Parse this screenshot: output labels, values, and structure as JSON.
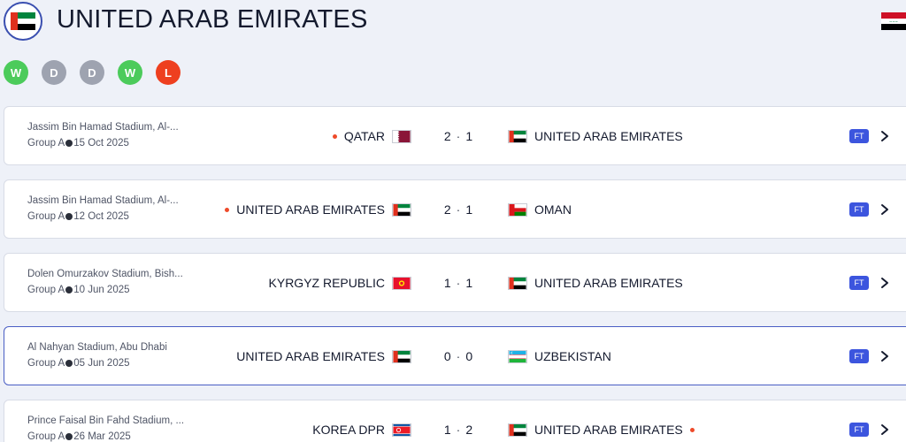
{
  "team": {
    "name": "UNITED ARAB EMIRATES",
    "badge_icon": "uae-flag-icon",
    "opponent_flag_icon": "iraq-flag-icon"
  },
  "form": [
    "W",
    "D",
    "D",
    "W",
    "L"
  ],
  "colors": {
    "win": "#4ccb5b",
    "draw": "#9ea3b0",
    "loss": "#ee3f1f",
    "ft_badge": "#3c55de",
    "selected_border": "#4a5ec4"
  },
  "matches": [
    {
      "venue": "Jassim Bin Hamad Stadium, Al-...",
      "group": "Group A",
      "date": "15 Oct 2025",
      "home": "QATAR",
      "home_flag": "qatar-flag-icon",
      "home_winner": true,
      "home_score": "2",
      "separator": "·",
      "away_score": "1",
      "away": "UNITED ARAB EMIRATES",
      "away_flag": "uae-flag-icon",
      "away_winner": false,
      "status": "FT"
    },
    {
      "venue": "Jassim Bin Hamad Stadium, Al-...",
      "group": "Group A",
      "date": "12 Oct 2025",
      "home": "UNITED ARAB EMIRATES",
      "home_flag": "uae-flag-icon",
      "home_winner": true,
      "home_score": "2",
      "separator": "·",
      "away_score": "1",
      "away": "OMAN",
      "away_flag": "oman-flag-icon",
      "away_winner": false,
      "status": "FT"
    },
    {
      "venue": "Dolen Omurzakov Stadium, Bish...",
      "group": "Group A",
      "date": "10 Jun 2025",
      "home": "KYRGYZ REPUBLIC",
      "home_flag": "kyrgyz-flag-icon",
      "home_winner": false,
      "home_score": "1",
      "separator": "·",
      "away_score": "1",
      "away": "UNITED ARAB EMIRATES",
      "away_flag": "uae-flag-icon",
      "away_winner": false,
      "status": "FT"
    },
    {
      "venue": "Al Nahyan Stadium, Abu Dhabi",
      "group": "Group A",
      "date": "05 Jun 2025",
      "home": "UNITED ARAB EMIRATES",
      "home_flag": "uae-flag-icon",
      "home_winner": false,
      "home_score": "0",
      "separator": "·",
      "away_score": "0",
      "away": "UZBEKISTAN",
      "away_flag": "uzbekistan-flag-icon",
      "away_winner": false,
      "status": "FT",
      "selected": true
    },
    {
      "venue": "Prince Faisal Bin Fahd Stadium, ...",
      "group": "Group A",
      "date": "26 Mar 2025",
      "home": "KOREA DPR",
      "home_flag": "korea-dpr-flag-icon",
      "home_winner": false,
      "home_score": "1",
      "separator": "·",
      "away_score": "2",
      "away": "UNITED ARAB EMIRATES",
      "away_flag": "uae-flag-icon",
      "away_winner": true,
      "status": "FT"
    }
  ]
}
